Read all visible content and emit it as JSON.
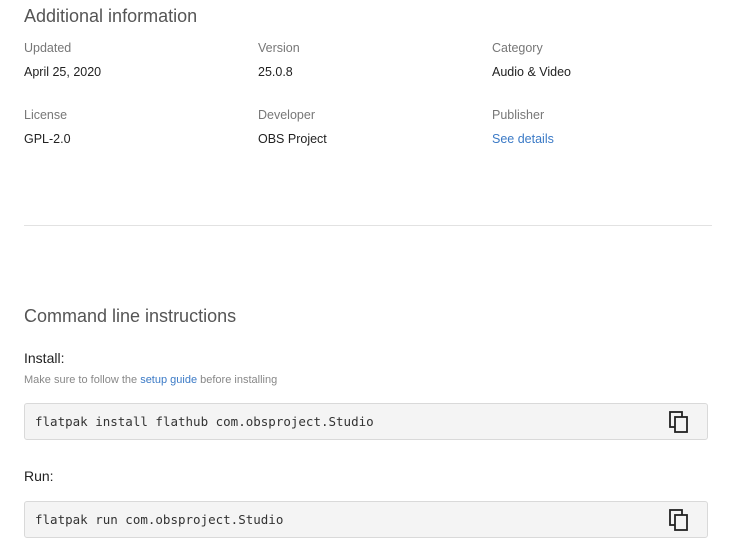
{
  "additional_info": {
    "title": "Additional information",
    "fields": [
      {
        "label": "Updated",
        "value": "April 25, 2020"
      },
      {
        "label": "Version",
        "value": "25.0.8"
      },
      {
        "label": "Category",
        "value": "Audio & Video"
      },
      {
        "label": "License",
        "value": "GPL-2.0"
      },
      {
        "label": "Developer",
        "value": "OBS Project"
      },
      {
        "label": "Publisher",
        "value": "See details"
      }
    ]
  },
  "command_line": {
    "title": "Command line instructions",
    "install": {
      "label": "Install:",
      "hint_before": "Make sure to follow the",
      "hint_link": "setup guide",
      "hint_after": "before installing",
      "command": "flatpak install flathub com.obsproject.Studio",
      "copy_icon": "copy-icon"
    },
    "run": {
      "label": "Run:",
      "command": "flatpak run com.obsproject.Studio",
      "copy_icon": "copy-icon"
    }
  },
  "colors": {
    "link": "#3b7ac6",
    "code_bg": "#f4f4f4",
    "divider": "#e2e2e2"
  }
}
